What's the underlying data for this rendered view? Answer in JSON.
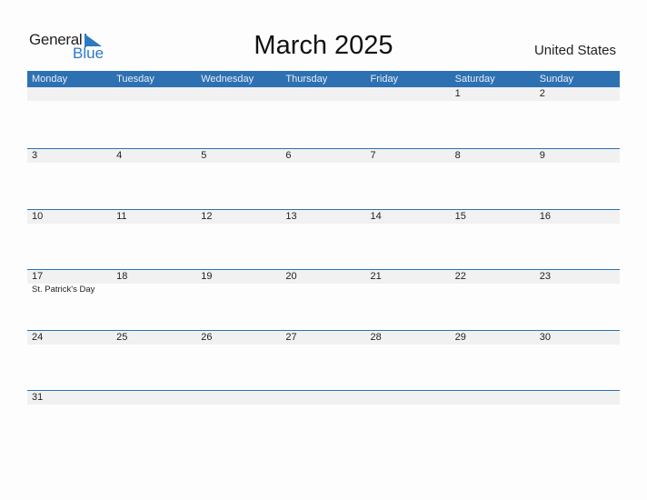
{
  "logo": {
    "word1": "General",
    "word2": "Blue"
  },
  "title": "March 2025",
  "country": "United States",
  "colors": {
    "accent": "#2e71b3",
    "band": "#f1f1f1"
  },
  "weekdays": [
    "Monday",
    "Tuesday",
    "Wednesday",
    "Thursday",
    "Friday",
    "Saturday",
    "Sunday"
  ],
  "weeks": [
    {
      "days": [
        "",
        "",
        "",
        "",
        "",
        "1",
        "2"
      ],
      "events": [
        "",
        "",
        "",
        "",
        "",
        "",
        ""
      ]
    },
    {
      "days": [
        "3",
        "4",
        "5",
        "6",
        "7",
        "8",
        "9"
      ],
      "events": [
        "",
        "",
        "",
        "",
        "",
        "",
        ""
      ]
    },
    {
      "days": [
        "10",
        "11",
        "12",
        "13",
        "14",
        "15",
        "16"
      ],
      "events": [
        "",
        "",
        "",
        "",
        "",
        "",
        ""
      ]
    },
    {
      "days": [
        "17",
        "18",
        "19",
        "20",
        "21",
        "22",
        "23"
      ],
      "events": [
        "St. Patrick's Day",
        "",
        "",
        "",
        "",
        "",
        ""
      ]
    },
    {
      "days": [
        "24",
        "25",
        "26",
        "27",
        "28",
        "29",
        "30"
      ],
      "events": [
        "",
        "",
        "",
        "",
        "",
        "",
        ""
      ]
    },
    {
      "days": [
        "31",
        "",
        "",
        "",
        "",
        "",
        ""
      ],
      "events": [
        "",
        "",
        "",
        "",
        "",
        "",
        ""
      ]
    }
  ]
}
